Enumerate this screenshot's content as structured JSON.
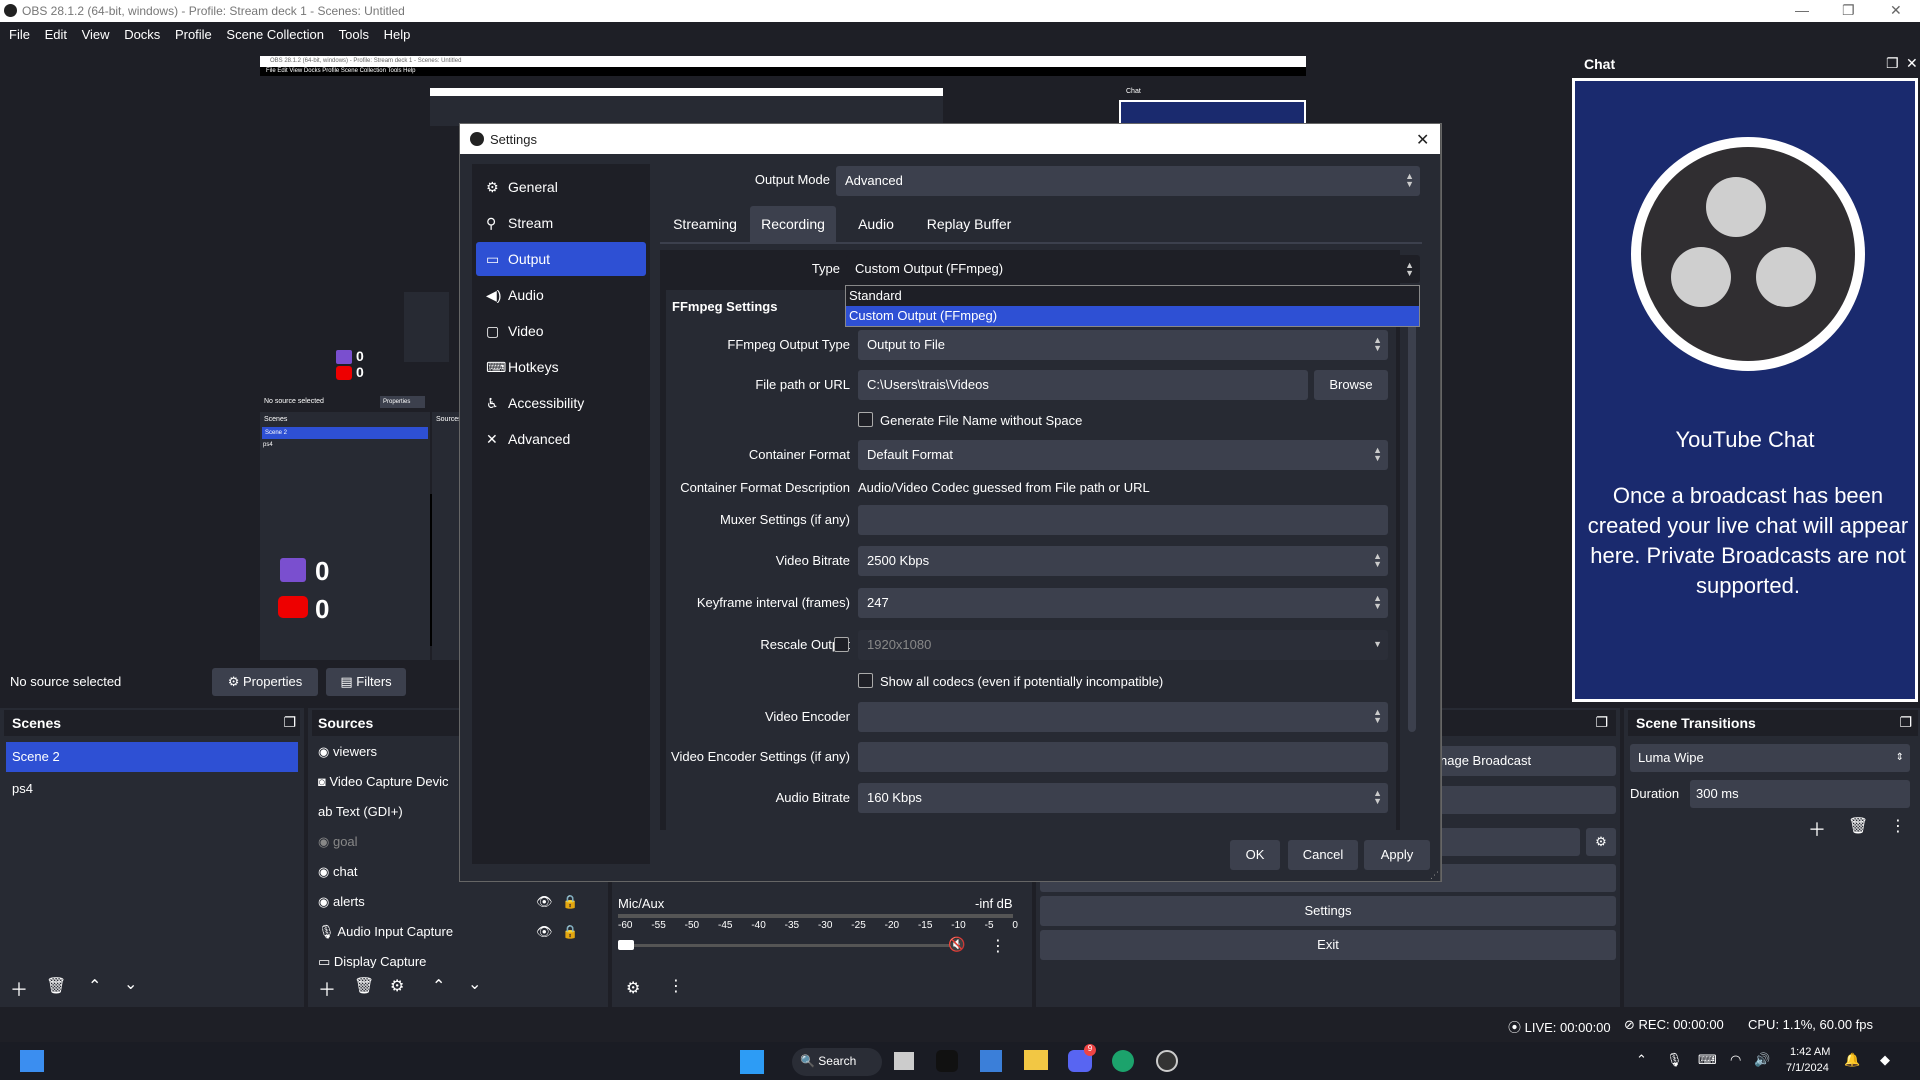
{
  "window": {
    "title": "OBS 28.1.2 (64-bit, windows) - Profile: Stream deck 1 - Scenes: Untitled"
  },
  "menu": [
    "File",
    "Edit",
    "View",
    "Docks",
    "Profile",
    "Scene Collection",
    "Tools",
    "Help"
  ],
  "preview": {
    "mini_title": "OBS 28.1.2 (64-bit, windows) - Profile: Stream deck 1 - Scenes: Untitled",
    "mini_menu": "File  Edit  View  Docks  Profile  Scene Collection  Tools  Help",
    "mini_chat": "Chat",
    "mini_no_source": "No source selected",
    "mini_props": "Properties",
    "mini_scenes": "Scenes",
    "mini_sources": "Sources",
    "mini_scene2": "Scene 2",
    "mini_ps4": "ps4",
    "twitch_count": "0",
    "youtube_count": "0",
    "small_twitch_count": "0",
    "small_youtube_count": "0"
  },
  "chat": {
    "header": "Chat",
    "title": "YouTube Chat",
    "message": "Once a broadcast has been created your live chat will appear here. Private Broadcasts are not supported."
  },
  "sourcebar": {
    "status": "No source selected",
    "properties": "Properties",
    "filters": "Filters"
  },
  "scenes": {
    "header": "Scenes",
    "items": [
      "Scene 2",
      "ps4"
    ]
  },
  "sources": {
    "header": "Sources",
    "items": [
      "viewers",
      "Video Capture Devic",
      "Text (GDI+)",
      "goal",
      "chat",
      "alerts",
      "Audio Input Capture",
      "Display Capture"
    ]
  },
  "audio": {
    "name": "Mic/Aux",
    "level": "-inf dB",
    "ticks": [
      "-60",
      "-55",
      "-50",
      "-45",
      "-40",
      "-35",
      "-30",
      "-25",
      "-20",
      "-15",
      "-10",
      "-5",
      "0"
    ]
  },
  "controls": {
    "manage_broadcast": "nage Broadcast",
    "settings": "Settings",
    "exit": "Exit"
  },
  "transitions": {
    "header": "Scene Transitions",
    "selected": "Luma Wipe",
    "duration_label": "Duration",
    "duration_value": "300 ms"
  },
  "settings": {
    "title": "Settings",
    "sidebar": [
      "General",
      "Stream",
      "Output",
      "Audio",
      "Video",
      "Hotkeys",
      "Accessibility",
      "Advanced"
    ],
    "active_sidebar": "Output",
    "output_mode_label": "Output Mode",
    "output_mode_value": "Advanced",
    "tabs": [
      "Streaming",
      "Recording",
      "Audio",
      "Replay Buffer"
    ],
    "active_tab": "Recording",
    "type_label": "Type",
    "type_value": "Custom Output (FFmpeg)",
    "type_options": [
      "Standard",
      "Custom Output (FFmpeg)"
    ],
    "section_title": "FFmpeg Settings",
    "ffmpeg_output_type_label": "FFmpeg Output Type",
    "ffmpeg_output_type_value": "Output to File",
    "file_path_label": "File path or URL",
    "file_path_value": "C:\\Users\\trais\\Videos",
    "browse": "Browse",
    "gen_filename_label": "Generate File Name without Space",
    "container_format_label": "Container Format",
    "container_format_value": "Default Format",
    "container_desc_label": "Container Format Description",
    "container_desc_value": "Audio/Video Codec guessed from File path or URL",
    "muxer_label": "Muxer Settings (if any)",
    "video_bitrate_label": "Video Bitrate",
    "video_bitrate_value": "2500 Kbps",
    "keyframe_label": "Keyframe interval (frames)",
    "keyframe_value": "247",
    "rescale_label": "Rescale Output",
    "rescale_value": "1920x1080",
    "show_codecs_label": "Show all codecs (even if potentially incompatible)",
    "video_encoder_label": "Video Encoder",
    "video_encoder_settings_label": "Video Encoder Settings (if any)",
    "audio_bitrate_label": "Audio Bitrate",
    "audio_bitrate_value": "160 Kbps",
    "ok": "OK",
    "cancel": "Cancel",
    "apply": "Apply"
  },
  "status": {
    "live": "LIVE: 00:00:00",
    "rec": "REC: 00:00:00",
    "cpu": "CPU: 1.1%, 60.00 fps"
  },
  "taskbar": {
    "search": "Search",
    "time": "1:42 AM",
    "date": "7/1/2024",
    "discord_badge": "9"
  }
}
